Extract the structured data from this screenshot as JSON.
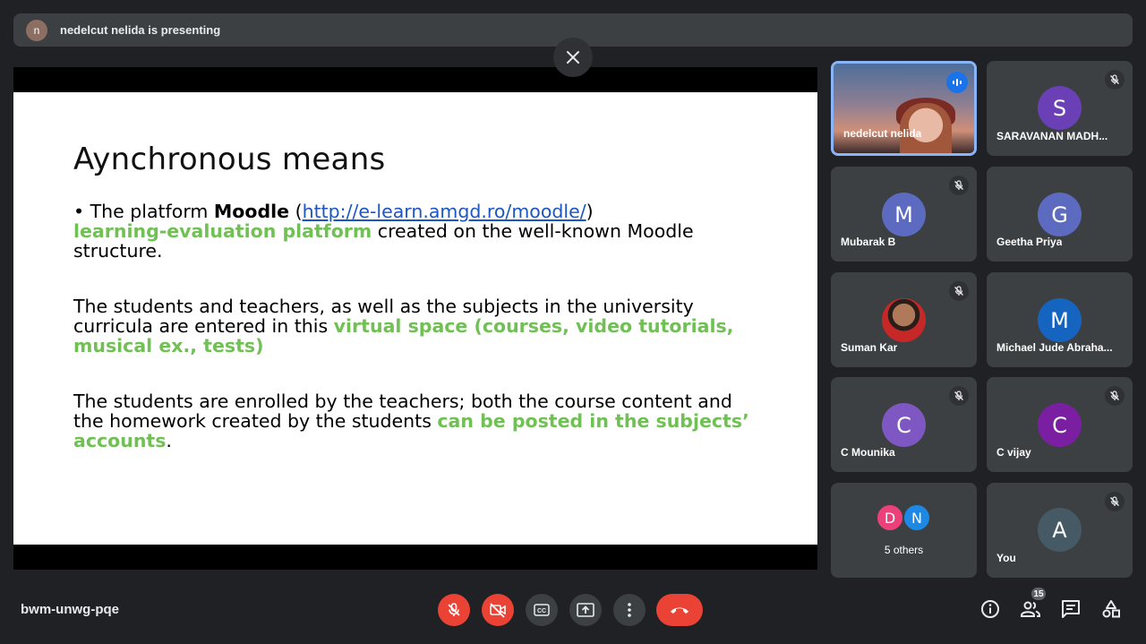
{
  "presenting_bar": {
    "avatar_letter": "n",
    "text": "nedelcut nelida is presenting"
  },
  "slide": {
    "title": "Aynchronous means",
    "p1_bullet": "• The platform ",
    "p1_bold": "Moodle",
    "p1_open": " (",
    "p1_link": "http://e-learn.amgd.ro/moodle/",
    "p1_close": ")",
    "p1_green": "learning-evaluation platform",
    "p1_rest": " created on the well-known Moodle structure.",
    "p2_text": "The students and teachers, as well as the subjects in the university curricula are entered in this ",
    "p2_green": "virtual space (courses, video tutorials, musical ex., tests)",
    "p3_text": " The students are enrolled by the teachers; both the course content and the homework created by the students ",
    "p3_green": "can be posted in the subjects’ accounts",
    "p3_end": "."
  },
  "participants": [
    {
      "name": "nedelcut nelida",
      "avatar": "",
      "color": "",
      "muted": false,
      "speaking": true
    },
    {
      "name": "SARAVANAN MADH...",
      "avatar": "S",
      "color": "#6b3fb5",
      "muted": true
    },
    {
      "name": "Mubarak B",
      "avatar": "M",
      "color": "#5c6bc0",
      "muted": true
    },
    {
      "name": "Geetha Priya",
      "avatar": "G",
      "color": "#5c6bc0",
      "muted": false
    },
    {
      "name": "Suman Kar",
      "avatar": "",
      "color": "",
      "muted": true
    },
    {
      "name": "Michael Jude Abraha...",
      "avatar": "M",
      "color": "#1565c0",
      "muted": false
    },
    {
      "name": "C Mounika",
      "avatar": "C",
      "color": "#7e57c2",
      "muted": true
    },
    {
      "name": "C vijay",
      "avatar": "C",
      "color": "#7b1fa2",
      "muted": true
    },
    {
      "name": "You",
      "avatar": "A",
      "color": "#455a64",
      "muted": true
    }
  ],
  "others": {
    "avatars": [
      {
        "letter": "D",
        "color": "#ec407a"
      },
      {
        "letter": "N",
        "color": "#1e88e5"
      }
    ],
    "label": "5 others"
  },
  "footer": {
    "meeting_code": "bwm-unwg-pqe",
    "participant_count": "15"
  },
  "icons": {
    "close": "close-icon",
    "mic_off": "mic-off-icon",
    "camera_off": "camera-off-icon",
    "captions": "captions-icon",
    "present": "present-screen-icon",
    "more": "more-vert-icon",
    "end_call": "end-call-icon",
    "info": "info-icon",
    "people": "people-icon",
    "chat": "chat-icon",
    "activities": "activities-icon"
  },
  "colors": {
    "background": "#202124",
    "danger": "#ea4335",
    "accent": "#8ab4f8",
    "slide_green": "#71c055",
    "link": "#1a56c4"
  }
}
